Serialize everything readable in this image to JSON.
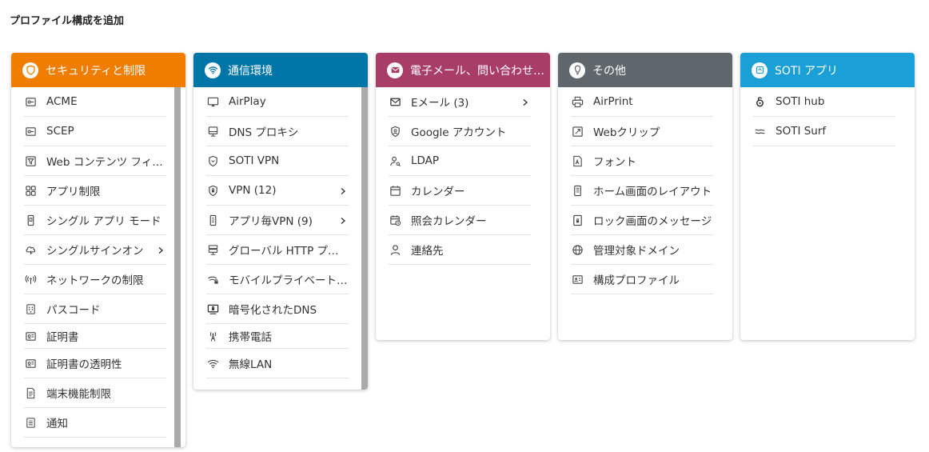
{
  "page": {
    "title": "プロファイル構成を追加"
  },
  "colors": {
    "security": "#f07d00",
    "network": "#0075a8",
    "email": "#a83e67",
    "other": "#5f666c",
    "soti": "#1a9fd6"
  },
  "cards": {
    "security": {
      "title": "セキュリティと制限",
      "items": [
        "ACME",
        "SCEP",
        "Web コンテンツ フィルター",
        "アプリ制限",
        "シングル アプリ モード",
        "シングルサインオン",
        "ネットワークの制限",
        "パスコード",
        "証明書",
        "証明書の透明性",
        "端末機能制限",
        "通知"
      ]
    },
    "network": {
      "title": "通信環境",
      "items": [
        "AirPlay",
        "DNS プロキシ",
        "SOTI VPN",
        "VPN (12)",
        "アプリ毎VPN (9)",
        "グローバル HTTP プロキシ",
        "モバイルプライベートネットワーク",
        "暗号化されたDNS",
        "携帯電話",
        "無線LAN"
      ]
    },
    "email": {
      "title": "電子メール、問い合わせ先、カレンダー",
      "items": [
        "Eメール (3)",
        "Google アカウント",
        "LDAP",
        "カレンダー",
        "照会カレンダー",
        "連絡先"
      ]
    },
    "other": {
      "title": "その他",
      "items": [
        "AirPrint",
        "Webクリップ",
        "フォント",
        "ホーム画面のレイアウト",
        "ロック画面のメッセージ",
        "管理対象ドメイン",
        "構成プロファイル"
      ]
    },
    "soti": {
      "title": "SOTI アプリ",
      "items": [
        "SOTI hub",
        "SOTI Surf"
      ]
    }
  }
}
